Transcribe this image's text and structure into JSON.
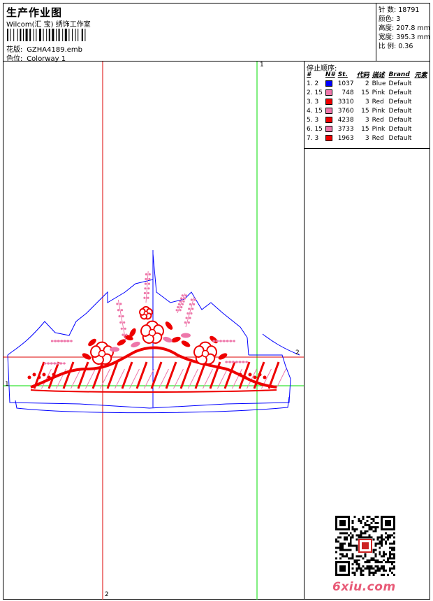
{
  "header": {
    "title": "生产作业图",
    "company": "Wilcom(汇 宝) 绣饰工作室",
    "design_label": "花版:",
    "design_value": "GZHA4189.emb",
    "colorway_label": "色位:",
    "colorway_value": "Colorway 1"
  },
  "stats": {
    "stitches": "针 数: 18791",
    "colors": "颜色: 3",
    "height": "高度: 207.8 mm",
    "width": "宽度: 395.3 mm",
    "scale": "比 例: 0.36"
  },
  "stop_sequence": {
    "caption": "停止顺序:",
    "columns": [
      "#",
      "N#",
      "St.",
      "代码",
      "描述",
      "Brand",
      "元素"
    ],
    "rows": [
      {
        "idx": "1. 2",
        "color": "#0000ff",
        "st": "1037",
        "code": "2",
        "desc": "Blue",
        "brand": "Default"
      },
      {
        "idx": "2. 15",
        "color": "#ee77aa",
        "st": "748",
        "code": "15",
        "desc": "Pink",
        "brand": "Default"
      },
      {
        "idx": "3. 3",
        "color": "#ee0000",
        "st": "3310",
        "code": "3",
        "desc": "Red",
        "brand": "Default"
      },
      {
        "idx": "4. 15",
        "color": "#ee77aa",
        "st": "3760",
        "code": "15",
        "desc": "Pink",
        "brand": "Default"
      },
      {
        "idx": "5. 3",
        "color": "#ee0000",
        "st": "4238",
        "code": "3",
        "desc": "Red",
        "brand": "Default"
      },
      {
        "idx": "6. 15",
        "color": "#ee77aa",
        "st": "3733",
        "code": "15",
        "desc": "Pink",
        "brand": "Default"
      },
      {
        "idx": "7. 3",
        "color": "#ee0000",
        "st": "1963",
        "code": "3",
        "desc": "Red",
        "brand": "Default"
      }
    ]
  },
  "guides": {
    "top": "1",
    "bottom": "2",
    "left": "1",
    "right": "2"
  },
  "colors": {
    "blue": "#0000ff",
    "pink": "#ee77aa",
    "red": "#ee0000",
    "green": "#00dd00",
    "guide_red": "#dd0000"
  },
  "watermark": {
    "text": "6xiu.com",
    "qr_icon": "qr-code-icon"
  }
}
